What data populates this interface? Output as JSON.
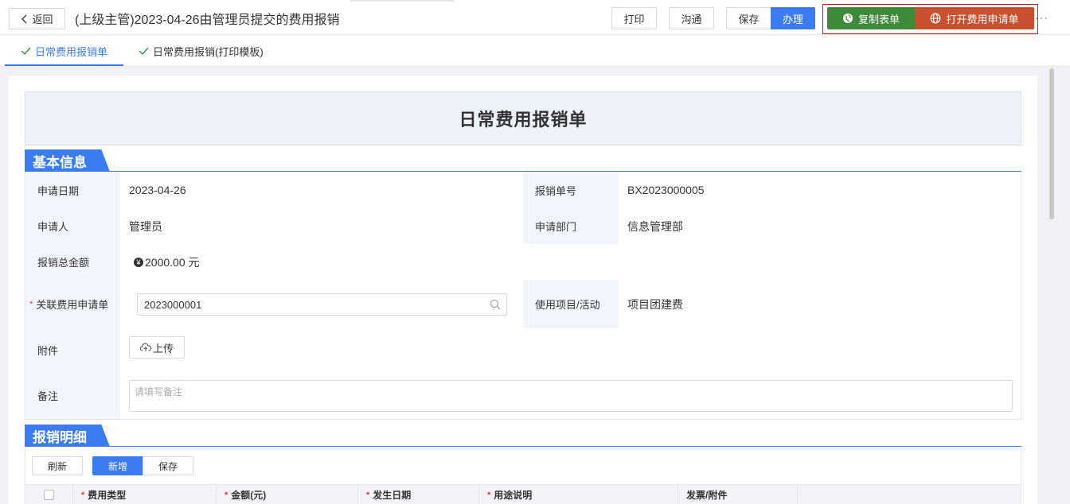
{
  "header": {
    "back_label": "返回",
    "title": "(上级主管)2023-04-26由管理员提交的费用报销",
    "print_label": "打印",
    "chat_label": "沟通",
    "save_label": "保存",
    "handle_label": "办理",
    "copy_label": "复制表单",
    "open_label": "打开费用申请单",
    "more_label": "···"
  },
  "tabs": [
    {
      "label": "日常费用报销单"
    },
    {
      "label": "日常费用报销(打印模板)"
    }
  ],
  "form": {
    "title": "日常费用报销单",
    "section_basic": "基本信息",
    "section_detail": "报销明细",
    "fields": {
      "apply_date_label": "申请日期",
      "apply_date_value": "2023-04-26",
      "number_label": "报销单号",
      "number_value": "BX2023000005",
      "applicant_label": "申请人",
      "applicant_value": "管理员",
      "dept_label": "申请部门",
      "dept_value": "信息管理部",
      "total_label": "报销总金额",
      "total_symbol": "¥",
      "total_value": "2000.00 元",
      "related_label": "关联费用申请单",
      "related_value": "2023000001",
      "project_label": "使用项目/活动",
      "project_value": "项目团建费",
      "attachment_label": "附件",
      "upload_label": "上传",
      "remark_label": "备注",
      "remark_placeholder": "请填写备注"
    },
    "detail": {
      "refresh_label": "刷新",
      "add_label": "新增",
      "save_label": "保存",
      "columns": [
        "费用类型",
        "金额(元)",
        "发生日期",
        "用途说明",
        "发票/附件"
      ]
    }
  },
  "colors": {
    "primary": "#3b7cf2",
    "copy_green": "#3e8a3a",
    "open_red": "#c8502f",
    "highlight": "#d7141c"
  }
}
